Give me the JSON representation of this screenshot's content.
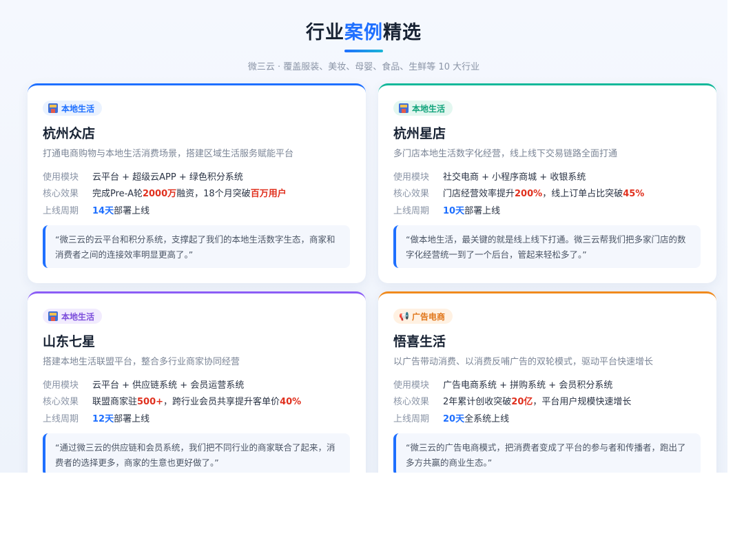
{
  "header": {
    "title_a": "行业",
    "title_hl": "案例",
    "title_b": "精选",
    "subtitle": "微三云 · 覆盖服装、美妆、母婴、食品、生鲜等 10 大行业"
  },
  "colors": {
    "accent": "#1e6fff",
    "highlight_red": "#e0301e",
    "tag_green": "#10a37a",
    "tag_purple": "#7c4ddb",
    "tag_orange": "#e0761a"
  },
  "cases": [
    {
      "tag": "本地生活",
      "tag_icon": "store-icon",
      "name": "杭州众店",
      "desc": "打通电商购物与本地生活消费场景，搭建区域生活服务赋能平台",
      "label_module": "使用模块",
      "module": "云平台 + 超级云APP + 绿色积分系统",
      "label_effect": "核心效果",
      "effect_1": "完成Pre-A轮",
      "effect_2": "2000万",
      "effect_3": "融资，18个月突破",
      "effect_4": "百万用户",
      "effect_5": "",
      "label_cycle": "上线周期",
      "cycle_num": "14天",
      "cycle_text": "部署上线",
      "quote": "“微三云的云平台和积分系统，支撑起了我们的本地生活数字生态，商家和消费者之间的连接效率明显更高了。”"
    },
    {
      "tag": "本地生活",
      "tag_icon": "store-icon",
      "name": "杭州星店",
      "desc": "多门店本地生活数字化经营，线上线下交易链路全面打通",
      "label_module": "使用模块",
      "module": "社交电商 + 小程序商城 + 收银系统",
      "label_effect": "核心效果",
      "effect_1": "门店经营效率提升",
      "effect_2": "200%",
      "effect_3": "，线上订单占比突破",
      "effect_4": "45%",
      "effect_5": "",
      "label_cycle": "上线周期",
      "cycle_num": "10天",
      "cycle_text": "部署上线",
      "quote": "“做本地生活，最关键的就是线上线下打通。微三云帮我们把多家门店的数字化经营统一到了一个后台，管起来轻松多了。”"
    },
    {
      "tag": "本地生活",
      "tag_icon": "store-icon",
      "name": "山东七星",
      "desc": "搭建本地生活联盟平台，整合多行业商家协同经营",
      "label_module": "使用模块",
      "module": "云平台 + 供应链系统 + 会员运营系统",
      "label_effect": "核心效果",
      "effect_1": "联盟商家驻",
      "effect_2": "500+",
      "effect_3": "，跨行业会员共享提升客单价",
      "effect_4": "40%",
      "effect_5": "",
      "label_cycle": "上线周期",
      "cycle_num": "12天",
      "cycle_text": "部署上线",
      "quote": "“通过微三云的供应链和会员系统，我们把不同行业的商家联合了起来，消费者的选择更多，商家的生意也更好做了。”"
    },
    {
      "tag": "广告电商",
      "tag_icon": "megaphone-icon",
      "name": "悟喜生活",
      "desc": "以广告带动消费、以消费反哺广告的双轮模式，驱动平台快速增长",
      "label_module": "使用模块",
      "module": "广告电商系统 + 拼购系统 + 会员积分系统",
      "label_effect": "核心效果",
      "effect_1": "2年累计创收突破",
      "effect_2": "20亿",
      "effect_3": "，平台用户规模快速增长",
      "effect_4": "",
      "effect_5": "",
      "label_cycle": "上线周期",
      "cycle_num": "20天",
      "cycle_text": "全系统上线",
      "quote": "“微三云的广告电商模式，把消费者变成了平台的参与者和传播者，跑出了多方共赢的商业生态。”"
    }
  ]
}
